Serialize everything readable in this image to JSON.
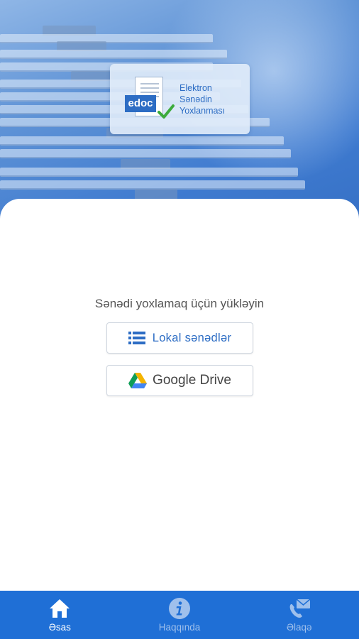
{
  "logo": {
    "badge": "edoc",
    "line1": "Elektron",
    "line2": "Sənədin",
    "line3": "Yoxlanması"
  },
  "main": {
    "prompt": "Sənədi yoxlamaq üçün yükləyin",
    "local_button_label": "Lokal sənədlər",
    "drive_button_label": "Google Drive"
  },
  "nav": {
    "items": [
      {
        "label": "Əsas",
        "icon": "home-icon",
        "active": true
      },
      {
        "label": "Haqqında",
        "icon": "info-icon",
        "active": false
      },
      {
        "label": "Əlaqə",
        "icon": "contact-phone-mail-icon",
        "active": false
      }
    ]
  },
  "colors": {
    "primary": "#1f6fd6",
    "accent_text": "#2d6dc4",
    "check_green": "#3cab3c",
    "nav_inactive": "#9fc0ec"
  }
}
